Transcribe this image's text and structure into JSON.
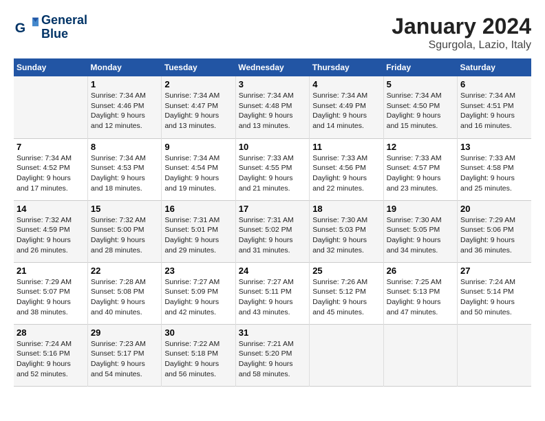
{
  "header": {
    "logo_line1": "General",
    "logo_line2": "Blue",
    "title": "January 2024",
    "subtitle": "Sgurgola, Lazio, Italy"
  },
  "weekdays": [
    "Sunday",
    "Monday",
    "Tuesday",
    "Wednesday",
    "Thursday",
    "Friday",
    "Saturday"
  ],
  "weeks": [
    [
      {
        "day": "",
        "info": ""
      },
      {
        "day": "1",
        "info": "Sunrise: 7:34 AM\nSunset: 4:46 PM\nDaylight: 9 hours\nand 12 minutes."
      },
      {
        "day": "2",
        "info": "Sunrise: 7:34 AM\nSunset: 4:47 PM\nDaylight: 9 hours\nand 13 minutes."
      },
      {
        "day": "3",
        "info": "Sunrise: 7:34 AM\nSunset: 4:48 PM\nDaylight: 9 hours\nand 13 minutes."
      },
      {
        "day": "4",
        "info": "Sunrise: 7:34 AM\nSunset: 4:49 PM\nDaylight: 9 hours\nand 14 minutes."
      },
      {
        "day": "5",
        "info": "Sunrise: 7:34 AM\nSunset: 4:50 PM\nDaylight: 9 hours\nand 15 minutes."
      },
      {
        "day": "6",
        "info": "Sunrise: 7:34 AM\nSunset: 4:51 PM\nDaylight: 9 hours\nand 16 minutes."
      }
    ],
    [
      {
        "day": "7",
        "info": "Sunrise: 7:34 AM\nSunset: 4:52 PM\nDaylight: 9 hours\nand 17 minutes."
      },
      {
        "day": "8",
        "info": "Sunrise: 7:34 AM\nSunset: 4:53 PM\nDaylight: 9 hours\nand 18 minutes."
      },
      {
        "day": "9",
        "info": "Sunrise: 7:34 AM\nSunset: 4:54 PM\nDaylight: 9 hours\nand 19 minutes."
      },
      {
        "day": "10",
        "info": "Sunrise: 7:33 AM\nSunset: 4:55 PM\nDaylight: 9 hours\nand 21 minutes."
      },
      {
        "day": "11",
        "info": "Sunrise: 7:33 AM\nSunset: 4:56 PM\nDaylight: 9 hours\nand 22 minutes."
      },
      {
        "day": "12",
        "info": "Sunrise: 7:33 AM\nSunset: 4:57 PM\nDaylight: 9 hours\nand 23 minutes."
      },
      {
        "day": "13",
        "info": "Sunrise: 7:33 AM\nSunset: 4:58 PM\nDaylight: 9 hours\nand 25 minutes."
      }
    ],
    [
      {
        "day": "14",
        "info": "Sunrise: 7:32 AM\nSunset: 4:59 PM\nDaylight: 9 hours\nand 26 minutes."
      },
      {
        "day": "15",
        "info": "Sunrise: 7:32 AM\nSunset: 5:00 PM\nDaylight: 9 hours\nand 28 minutes."
      },
      {
        "day": "16",
        "info": "Sunrise: 7:31 AM\nSunset: 5:01 PM\nDaylight: 9 hours\nand 29 minutes."
      },
      {
        "day": "17",
        "info": "Sunrise: 7:31 AM\nSunset: 5:02 PM\nDaylight: 9 hours\nand 31 minutes."
      },
      {
        "day": "18",
        "info": "Sunrise: 7:30 AM\nSunset: 5:03 PM\nDaylight: 9 hours\nand 32 minutes."
      },
      {
        "day": "19",
        "info": "Sunrise: 7:30 AM\nSunset: 5:05 PM\nDaylight: 9 hours\nand 34 minutes."
      },
      {
        "day": "20",
        "info": "Sunrise: 7:29 AM\nSunset: 5:06 PM\nDaylight: 9 hours\nand 36 minutes."
      }
    ],
    [
      {
        "day": "21",
        "info": "Sunrise: 7:29 AM\nSunset: 5:07 PM\nDaylight: 9 hours\nand 38 minutes."
      },
      {
        "day": "22",
        "info": "Sunrise: 7:28 AM\nSunset: 5:08 PM\nDaylight: 9 hours\nand 40 minutes."
      },
      {
        "day": "23",
        "info": "Sunrise: 7:27 AM\nSunset: 5:09 PM\nDaylight: 9 hours\nand 42 minutes."
      },
      {
        "day": "24",
        "info": "Sunrise: 7:27 AM\nSunset: 5:11 PM\nDaylight: 9 hours\nand 43 minutes."
      },
      {
        "day": "25",
        "info": "Sunrise: 7:26 AM\nSunset: 5:12 PM\nDaylight: 9 hours\nand 45 minutes."
      },
      {
        "day": "26",
        "info": "Sunrise: 7:25 AM\nSunset: 5:13 PM\nDaylight: 9 hours\nand 47 minutes."
      },
      {
        "day": "27",
        "info": "Sunrise: 7:24 AM\nSunset: 5:14 PM\nDaylight: 9 hours\nand 50 minutes."
      }
    ],
    [
      {
        "day": "28",
        "info": "Sunrise: 7:24 AM\nSunset: 5:16 PM\nDaylight: 9 hours\nand 52 minutes."
      },
      {
        "day": "29",
        "info": "Sunrise: 7:23 AM\nSunset: 5:17 PM\nDaylight: 9 hours\nand 54 minutes."
      },
      {
        "day": "30",
        "info": "Sunrise: 7:22 AM\nSunset: 5:18 PM\nDaylight: 9 hours\nand 56 minutes."
      },
      {
        "day": "31",
        "info": "Sunrise: 7:21 AM\nSunset: 5:20 PM\nDaylight: 9 hours\nand 58 minutes."
      },
      {
        "day": "",
        "info": ""
      },
      {
        "day": "",
        "info": ""
      },
      {
        "day": "",
        "info": ""
      }
    ]
  ]
}
